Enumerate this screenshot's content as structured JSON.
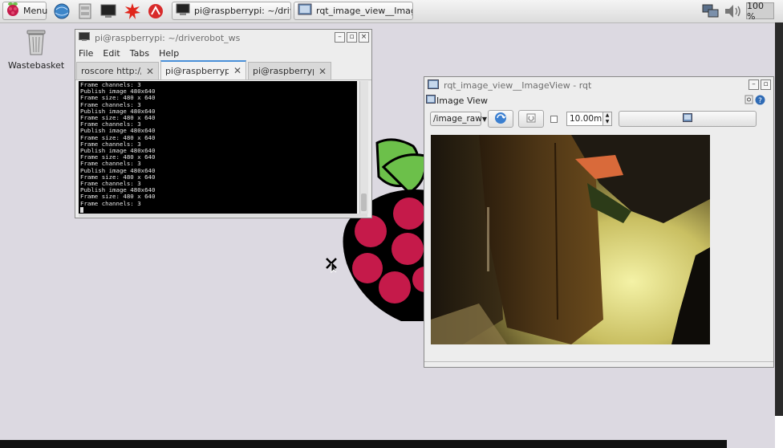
{
  "taskbar": {
    "menu_label": "Menu",
    "launchers": [
      "web-browser-icon",
      "file-manager-icon",
      "terminal-icon",
      "mathematica-icon",
      "wolfram-icon"
    ],
    "tasks": [
      {
        "label": "pi@raspberrypi: ~/drivero…",
        "icon": "terminal-icon"
      },
      {
        "label": "rqt_image_view__ImageVi…",
        "icon": "image-window-icon"
      }
    ],
    "cpu_label": "100 %"
  },
  "desktop": {
    "wastebasket_label": "Wastebasket"
  },
  "terminal": {
    "title": "pi@raspberrypi: ~/driverobot_ws",
    "menu": [
      "File",
      "Edit",
      "Tabs",
      "Help"
    ],
    "tabs": [
      {
        "label": "roscore http://ra…",
        "active": false
      },
      {
        "label": "pi@raspberrypi: …",
        "active": true
      },
      {
        "label": "pi@raspberrypi: …",
        "active": false
      }
    ],
    "lines": [
      "Frame channels: 3",
      "Publish image 480x640",
      "Frame size: 480 x 640",
      "Frame channels: 3",
      "Publish image 480x640",
      "Frame size: 480 x 640",
      "Frame channels: 3",
      "Publish image 480x640",
      "Frame size: 480 x 640",
      "Frame channels: 3",
      "Publish image 480x640",
      "Frame size: 480 x 640",
      "Frame channels: 3",
      "Publish image 480x640",
      "Frame size: 480 x 640",
      "Frame channels: 3",
      "Publish image 480x640",
      "Frame size: 480 x 640",
      "Frame channels: 3"
    ]
  },
  "rqt": {
    "title": "rqt_image_view__ImageView - rqt",
    "dock_title": "Image View",
    "topic": "/image_raw",
    "timeout": "10.00m",
    "colors": {
      "accent": "#4a90d9",
      "raspberry": "#c51a4a",
      "leaf": "#6cc04a"
    }
  }
}
